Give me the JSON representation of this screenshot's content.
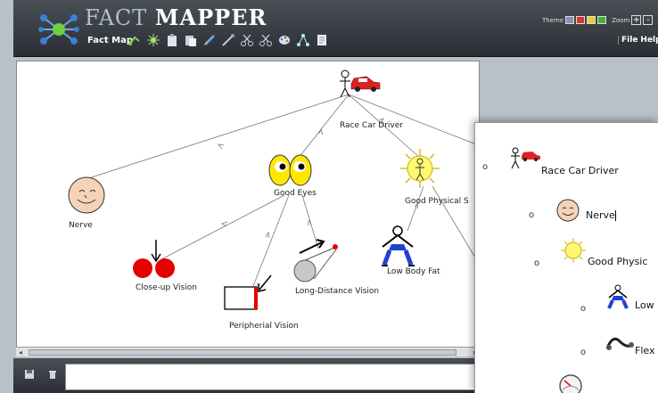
{
  "app": {
    "title_part1": "FACT",
    "title_part2": "MAPPER",
    "mode": "Fact Map",
    "theme_label": "Theme",
    "zoom_label": "Zoom",
    "zoom_in": "+",
    "zoom_out": "-",
    "menu": {
      "file": "File",
      "help": "Help"
    },
    "theme_colors": [
      "#8a8fb8",
      "#e03030",
      "#e8d030",
      "#40b040"
    ]
  },
  "map": {
    "nodes": [
      {
        "label": "Race Car Driver"
      },
      {
        "label": "Nerve"
      },
      {
        "label": "Good Eyes"
      },
      {
        "label": "Good Physical S"
      },
      {
        "label": "Close-up Vision"
      },
      {
        "label": "Peripherial Vision"
      },
      {
        "label": "Long-Distance Vision"
      },
      {
        "label": "Low Body Fat"
      }
    ]
  },
  "outline": {
    "items": [
      {
        "label": "Race Car Driver"
      },
      {
        "label": "Nerve"
      },
      {
        "label": "Good Physic"
      },
      {
        "label": "Low"
      },
      {
        "label": "Flex"
      }
    ]
  },
  "scroll": {
    "arrow_left": "◂",
    "arrow_right": "▸"
  }
}
